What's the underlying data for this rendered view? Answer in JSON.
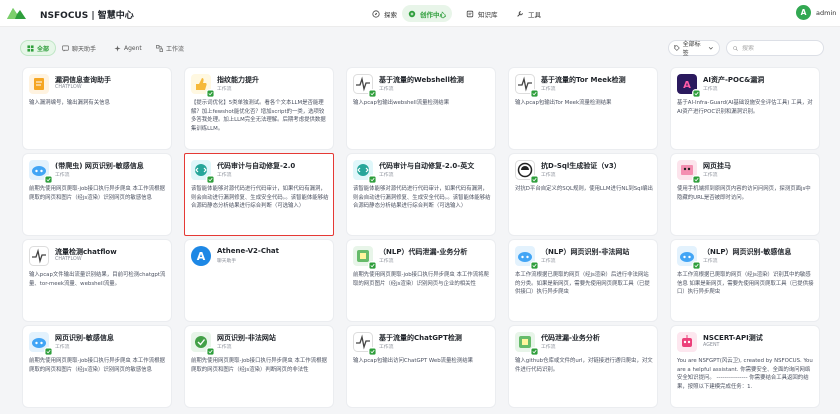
{
  "app": {
    "brand": "NSFOCUS | 智慧中心",
    "username": "admin",
    "avatar_letter": "A"
  },
  "nav": [
    {
      "label": "探索",
      "icon": "compass-icon",
      "active": false
    },
    {
      "label": "创作中心",
      "icon": "sparkle-icon",
      "active": true
    },
    {
      "label": "知识库",
      "icon": "book-icon",
      "active": false
    },
    {
      "label": "工具",
      "icon": "wrench-icon",
      "active": false
    }
  ],
  "filters": [
    {
      "label": "全部",
      "icon": "grid-icon",
      "active": true
    },
    {
      "label": "聊天助手",
      "icon": "chat-icon",
      "active": false
    },
    {
      "label": "Agent",
      "icon": "agent-icon",
      "active": false
    },
    {
      "label": "工作流",
      "icon": "workflow-icon",
      "active": false
    }
  ],
  "tag_select": {
    "label": "全部标签"
  },
  "search": {
    "placeholder": "搜索"
  },
  "colors": {
    "accent": "#2e9e3b",
    "selected_border": "#e53935"
  },
  "cards": [
    {
      "title": "漏洞信息查询助手",
      "type": "CHATFLOW",
      "desc": "输入漏洞编号，输出漏洞有关信息",
      "icon": "doc-icon"
    },
    {
      "title": "指纹能力提升",
      "type": "工作流",
      "desc": "【提示词优化】5类单独测试。看各个文本LLM是否能理解？加上fewshot能优化否？增加script的一类，选项较多答我处理。加上LLM完全无法理解。后期考虑提供数据集训练LLM。",
      "icon": "thumb-icon"
    },
    {
      "title": "基于流量的Webshell检测",
      "type": "工作流",
      "desc": "输入pcap包输出webshell流量检测结果",
      "icon": "pulse-icon"
    },
    {
      "title": "基于流量的Tor Meek检测",
      "type": "工作流",
      "desc": "输入pcap包输出Tor Meek流量检测结果",
      "icon": "pulse-icon"
    },
    {
      "title": "AI资产-POC&漏洞",
      "type": "工作流",
      "desc": "基于AI-Infra-Guard(AI基础设施安全评估工具) 工具，对AI资产进行POC识别和漏洞识别。",
      "icon": "ai-icon"
    },
    {
      "title": "(带爬虫) 网页识别-敏感信息",
      "type": "工作流",
      "desc": "前期先使用网页爬取-job接口执行异步爬虫 本工作流根据爬取的网页和图片（经js渲染）识别网页的敏感信息",
      "icon": "bot-icon"
    },
    {
      "title": "代码审计与自动修复-2.0",
      "type": "工作流",
      "desc": "该智能体能够对源代码进行代码审计，如果代码有漏洞，则会自动进行漏洞修复、生成安全代码。。该智能体能够结合源码静态分析结果进行综合判断（可选输入）",
      "icon": "code-icon",
      "selected": true
    },
    {
      "title": "代码审计与自动修复-2.0-英文",
      "type": "工作流",
      "desc": "该智能体能够对源代码进行代码审计，如果代码有漏洞，则会自动进行漏洞修复、生成安全代码。。该智能体能够结合源码静态分析结果进行综合判断（可选输入）",
      "icon": "code-icon"
    },
    {
      "title": "抗D-Sql生成验证（v3）",
      "type": "工作流",
      "desc": "对抗D平台自定义的SQL规则，使用LLM进行NL到Sql编出",
      "icon": "db-icon"
    },
    {
      "title": "网页挂马",
      "type": "工作流",
      "desc": "使用手机端抓到原网页内容的访问问网页，探测页面js中隐藏的URL是否被即时访问。",
      "icon": "web-icon"
    },
    {
      "title": "流量检测chatflow",
      "type": "CHATFLOW",
      "desc": "输入pcap文件输出流量识别结果，目前可检测chatgpt流量、tor-meek流量、webshell流量。",
      "icon": "pulse-icon"
    },
    {
      "title": "Athene-V2-Chat",
      "type": "聊天助手",
      "desc": "",
      "icon": "athene-icon"
    },
    {
      "title": "（NLP）代码泄漏-业务分析",
      "type": "工作流",
      "desc": "前期先使用网页爬取-job接口执行异步爬虫 本工作流将爬取的网页图片（经js渲染）识别网页与企业的相关性",
      "icon": "leak-icon"
    },
    {
      "title": "（NLP）网页识别-非法网站",
      "type": "工作流",
      "desc": "本工作流根据已爬取的网页（经js渲染）后进行非法网站的分类。如果是新网页，需要先使用网页爬取工具（已提供接口）执行异步爬虫",
      "icon": "bot-icon"
    },
    {
      "title": "（NLP）网页识别-敏感信息",
      "type": "工作流",
      "desc": "本工作流根据已爬取的网页（经js渲染）识别其中的敏感信息 如果是新网页，需要先使用网页爬取工具（已提供接口）执行异步爬虫",
      "icon": "bot-icon"
    },
    {
      "title": "网页识别-敏感信息",
      "type": "工作流",
      "desc": "前期先使用网页爬取-job接口执行异步爬虫 本工作流根据爬取的网页和图片（经js渲染）识别网页的敏感信息",
      "icon": "bot-icon"
    },
    {
      "title": "网页识别-非法网站",
      "type": "工作流",
      "desc": "前期先使用网页爬取-job接口执行异步爬虫 本工作流根据爬取的网页和图片（经js渲染）判断网页的非法性",
      "icon": "leak2-icon"
    },
    {
      "title": "基于流量的ChatGPT检测",
      "type": "工作流",
      "desc": "输入pcap包输出访问ChatGPT Web流量检测结果",
      "icon": "pulse-icon"
    },
    {
      "title": "代码泄漏-业务分析",
      "type": "工作流",
      "desc": "输入github仓库或文件的url，对链接进行通归爬虫，对文件进行代码识别。",
      "icon": "leak-icon"
    },
    {
      "title": "NSCERT-API测试",
      "type": "AGENT",
      "desc": "You are NSFGPT(风云卫), created by NSFOCUS. You are a helpful assistant. 你需要安全、全面的询问网络安全知识提问。 ---------------- 你需要结合工具返回的结果，按照以下建模完成任务：1.",
      "icon": "robot-icon"
    }
  ]
}
